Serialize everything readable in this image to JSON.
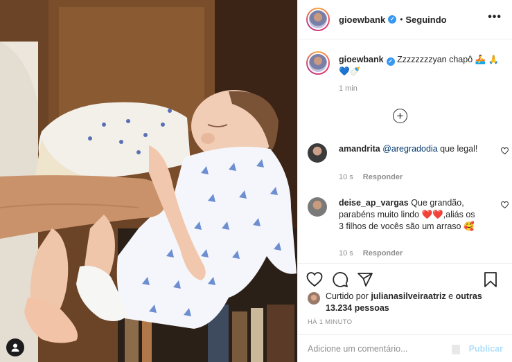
{
  "post": {
    "username": "gioewbank",
    "dot": "•",
    "follow_status": "Seguindo",
    "more_label": "•••"
  },
  "caption": {
    "username": "gioewbank",
    "text": "Zzzzzzzzyan chapô 🚣 🙏💙🍼",
    "time": "1 min"
  },
  "load_more_label": "+",
  "comments": [
    {
      "username": "amandrita",
      "mention": "@aregradodia",
      "text": " que legal!",
      "time": "10 s",
      "reply": "Responder"
    },
    {
      "username": "deise_ap_vargas",
      "text_before": " Que grandão, parabéns muito lindo ",
      "hearts": "❤️❤️",
      "text_after": ",aliás os 3 filhos de vocês são um arraso 🥰",
      "time": "10 s",
      "reply": "Responder"
    }
  ],
  "likes": {
    "prefix": "Curtido por ",
    "user": "julianasilveiraatriz",
    "middle": " e ",
    "others": "outras 13.234 pessoas"
  },
  "post_time": "HÁ 1 MINUTO",
  "add_comment": {
    "placeholder": "Adicione um comentário...",
    "publish_label": "Publicar"
  },
  "colors": {
    "verified": "#3897f0",
    "publish_disabled": "#b2dffc",
    "mention": "#00376b",
    "heart_red": "#ed4956"
  },
  "icons": {
    "like": "heart-icon",
    "comment": "comment-icon",
    "share": "paper-plane-icon",
    "save": "bookmark-icon",
    "more": "more-options-icon",
    "tag": "user-tag-icon"
  }
}
